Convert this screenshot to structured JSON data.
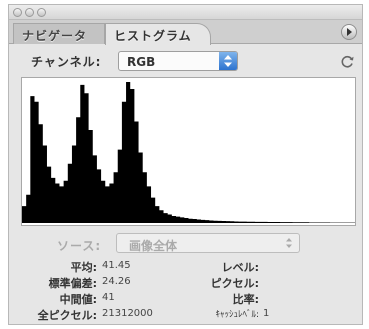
{
  "tabs": [
    {
      "label": "ナビゲータ",
      "active": false
    },
    {
      "label": "ヒストグラム",
      "active": true
    }
  ],
  "channel": {
    "label": "チャンネル:",
    "value": "RGB"
  },
  "source": {
    "label": "ソース:",
    "value": "画像全体"
  },
  "stats_left": [
    {
      "label": "平均:",
      "value": "41.45"
    },
    {
      "label": "標準偏差:",
      "value": "24.26"
    },
    {
      "label": "中間値:",
      "value": "41"
    },
    {
      "label": "全ピクセル:",
      "value": "21312000"
    }
  ],
  "stats_right": [
    {
      "label": "レベル:",
      "value": ""
    },
    {
      "label": "ピクセル:",
      "value": ""
    },
    {
      "label": "比率:",
      "value": ""
    },
    {
      "label": "ｷｬｯｼｭﾚﾍﾞﾙ:",
      "value": "1"
    }
  ],
  "histogram": {
    "color": "#000000",
    "levels": [
      0.12,
      0.2,
      0.9,
      0.86,
      0.7,
      0.55,
      0.4,
      0.32,
      0.28,
      0.26,
      0.3,
      0.42,
      0.55,
      0.75,
      0.98,
      0.92,
      0.66,
      0.48,
      0.38,
      0.3,
      0.26,
      0.28,
      0.36,
      0.52,
      0.86,
      1.0,
      0.95,
      0.72,
      0.5,
      0.36,
      0.26,
      0.18,
      0.12,
      0.09,
      0.07,
      0.06,
      0.05,
      0.045,
      0.04,
      0.035,
      0.03,
      0.028,
      0.025,
      0.022,
      0.02,
      0.018,
      0.016,
      0.015,
      0.014,
      0.013,
      0.012,
      0.011,
      0.01,
      0.01,
      0.009,
      0.009,
      0.008,
      0.008,
      0.008,
      0.007,
      0.007,
      0.007,
      0.006,
      0.006,
      0.006,
      0.005,
      0.005,
      0.005,
      0.005,
      0.004,
      0.004,
      0.004,
      0.004,
      0.004,
      0.003,
      0.003,
      0.003,
      0.003,
      0.003,
      0.003
    ]
  }
}
